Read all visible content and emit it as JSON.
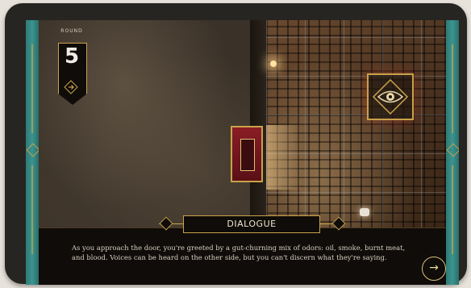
{
  "round": {
    "label": "ROUND",
    "number": "5",
    "arrow_icon": "arrow-right-icon"
  },
  "board": {
    "door_icon": "door-icon",
    "eye_icon": "eye-icon",
    "accent_color": "#c9a24a",
    "rail_color": "#3b9490"
  },
  "dialogue": {
    "title": "DIALOGUE",
    "text": "As you approach the door, you're greeted by a gut-churning mix of odors: oil, smoke, burnt meat, and blood. Voices can be heard on the other side, but you can't discern what they're saying.",
    "next_icon": "arrow-right-circle-icon",
    "next_glyph": "→"
  }
}
